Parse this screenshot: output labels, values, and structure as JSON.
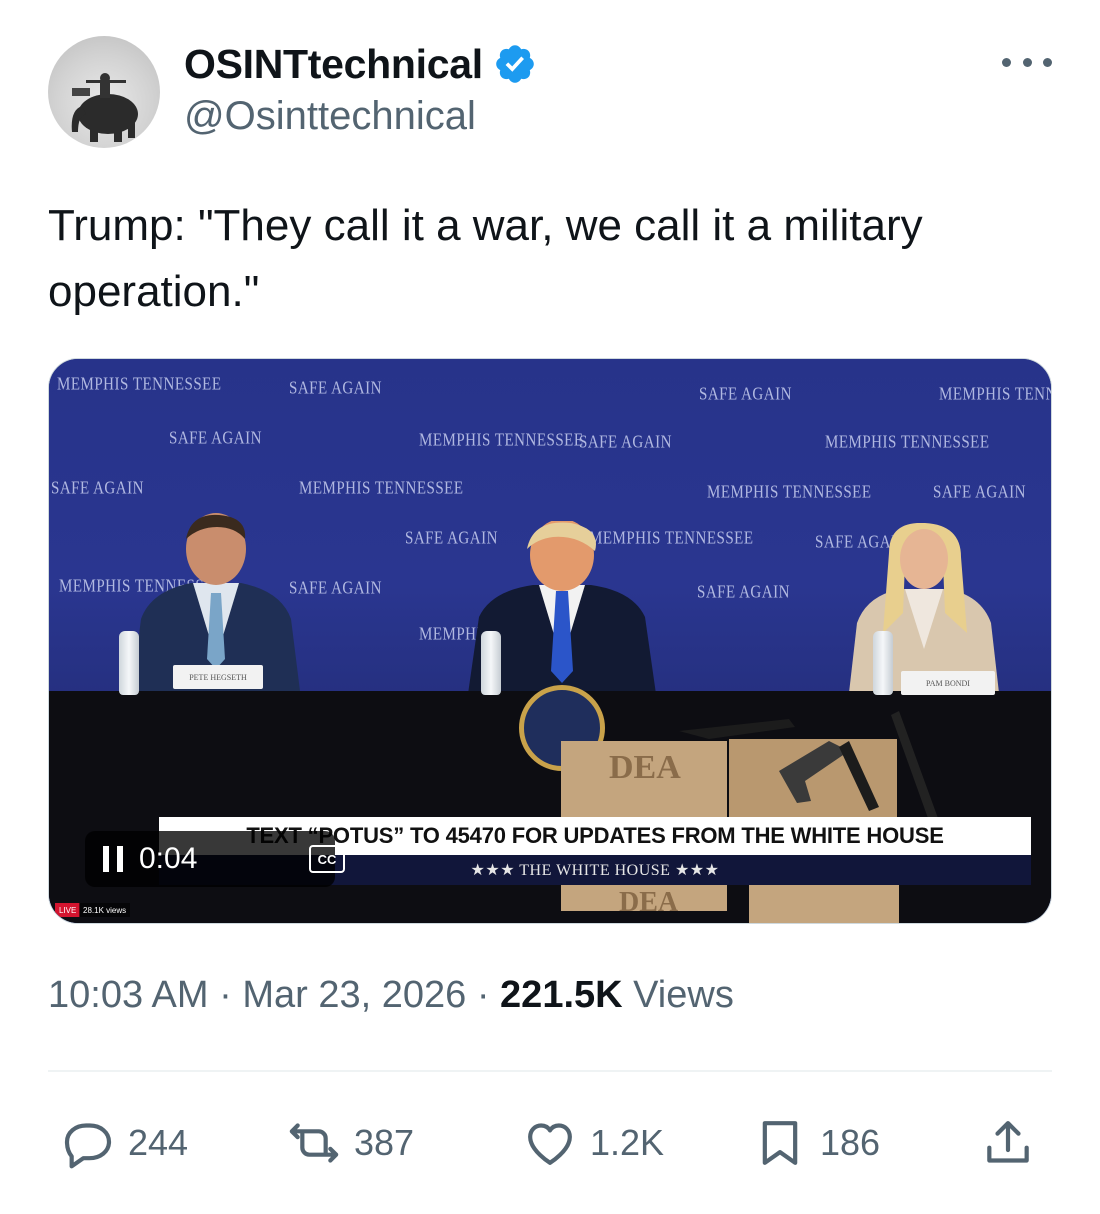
{
  "author": {
    "display_name": "OSINTtechnical",
    "handle": "@Osinttechnical",
    "verified": true,
    "avatar_icon": "avatar-elephant-icon"
  },
  "tweet": {
    "text": "Trump: \"They call it a war, we call it a military operation.\""
  },
  "media": {
    "backdrop_texts": [
      "MEMPHIS TENNESSEE",
      "SAFE AGAIN"
    ],
    "nameplates": [
      "PETE HEGSETH",
      "PAM BONDI"
    ],
    "box_labels": [
      "DEA"
    ],
    "ticker_text": "TEXT “POTUS” TO 45470 FOR UPDATES FROM THE WHITE HOUSE",
    "ticker_sub": "★★★  THE WHITE HOUSE  ★★★",
    "player": {
      "time": "0:04",
      "cc_label": "CC"
    },
    "live_badge": "LIVE",
    "live_views": "28.1K views"
  },
  "meta": {
    "time": "10:03 AM",
    "separator": " · ",
    "date": "Mar 23, 2026",
    "views_count": "221.5K",
    "views_label": " Views"
  },
  "actions": {
    "replies": "244",
    "reposts": "387",
    "likes": "1.2K",
    "bookmarks": "186"
  },
  "colors": {
    "verified_blue": "#1d9bf0",
    "secondary_text": "#536471",
    "primary_text": "#0f1419"
  }
}
